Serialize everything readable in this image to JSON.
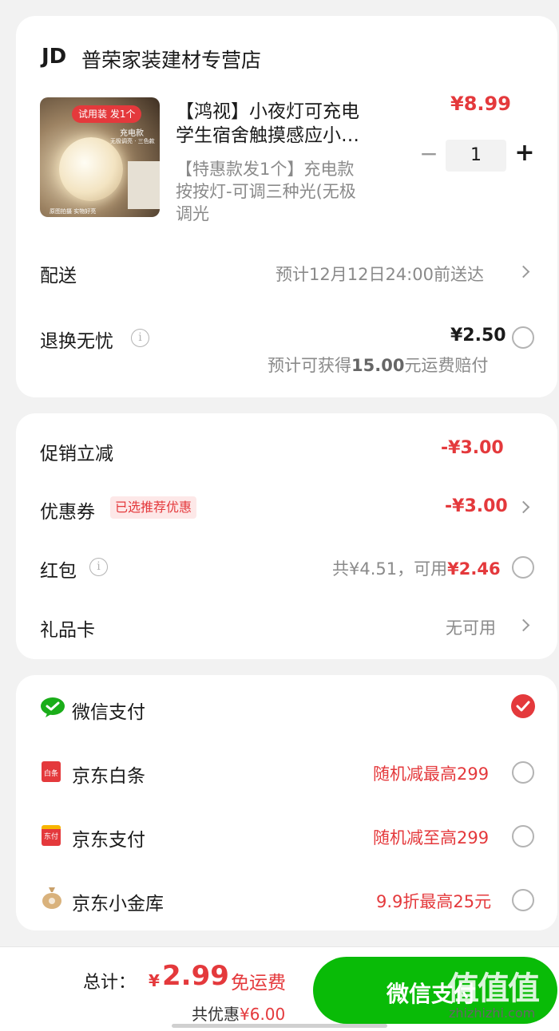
{
  "store": {
    "logo": "JD",
    "name": "普荣家装建材专营店"
  },
  "product": {
    "thumb_badge": "试用装 发1个",
    "thumb_sub1": "充电款",
    "thumb_sub2": "无极调亮 · 三色款",
    "thumb_foot": "原图拍摄 实物好亮",
    "title_line1": "【鸿视】小夜灯可充电",
    "title_line2": "学生宿舍触摸感应小…",
    "spec_line1": "【特惠款发1个】充电款",
    "spec_line2": "按按灯-可调三种光(无极",
    "spec_line3": "调光",
    "price": "¥8.99",
    "qty": "1",
    "minus": "−",
    "plus": "+"
  },
  "delivery": {
    "label": "配送",
    "value": "预计12月12日24:00前送达"
  },
  "returns": {
    "label": "退换无忧",
    "info": "i",
    "price": "¥2.50",
    "note_pre": "预计可获得",
    "note_amount": "15.00",
    "note_post": "元运费赔付"
  },
  "discounts": {
    "promo": {
      "label": "促销立减",
      "value": "-¥3.00"
    },
    "coupon": {
      "label": "优惠券",
      "tag": "已选推荐优惠",
      "value": "-¥3.00"
    },
    "redpacket": {
      "label": "红包",
      "info": "i",
      "total": "共¥4.51，可用",
      "usable": "¥2.46"
    },
    "giftcard": {
      "label": "礼品卡",
      "value": "无可用"
    }
  },
  "payments": {
    "wechat": {
      "label": "微信支付"
    },
    "baitiao": {
      "label": "京东白条",
      "promo": "随机减最高299",
      "icon_text": "白条"
    },
    "jdpay": {
      "label": "京东支付",
      "promo": "随机减至高299",
      "icon_text": "东付"
    },
    "jinku": {
      "label": "京东小金库",
      "promo": "9.9折最高25元"
    }
  },
  "footer": {
    "total_label": "总计：",
    "currency": "¥",
    "total": "2.99",
    "free_ship": "免运费",
    "saved_pre": "共优惠",
    "saved": "¥6.00",
    "pay_button": "微信支付"
  },
  "watermark": {
    "text": "值值值",
    "url": "zhizhizhi.com"
  },
  "colors": {
    "accent": "#e4393c",
    "wechat_green": "#1aad19",
    "pay_button": "#09bb07"
  }
}
